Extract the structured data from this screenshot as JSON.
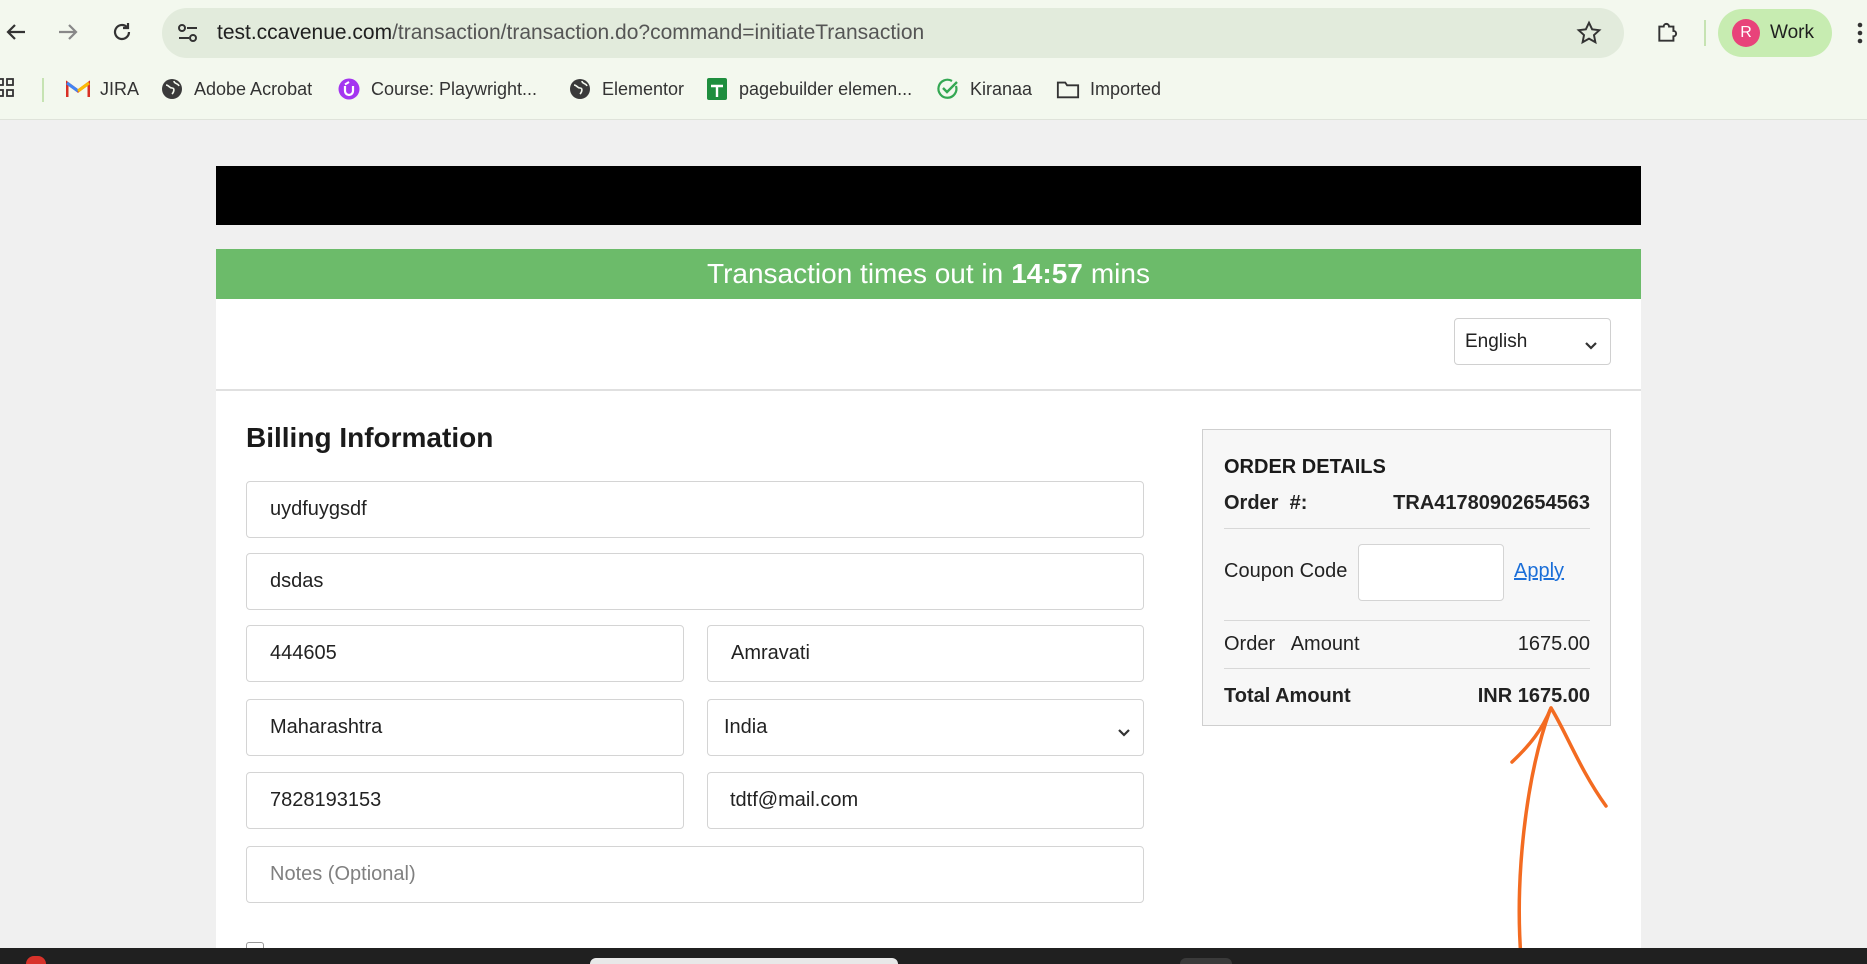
{
  "browser": {
    "url_host": "test.ccavenue.com",
    "url_path": "/transaction/transaction.do?command=initiateTransaction",
    "profile_initial": "R",
    "profile_name": "Work",
    "bookmarks": [
      {
        "label": "JIRA",
        "icon": "gmail-icon"
      },
      {
        "label": "Adobe Acrobat",
        "icon": "globe-icon"
      },
      {
        "label": "Course: Playwright...",
        "icon": "course-icon"
      },
      {
        "label": "Elementor",
        "icon": "globe-icon"
      },
      {
        "label": "pagebuilder elemen...",
        "icon": "sheets-icon"
      },
      {
        "label": "Kiranaa",
        "icon": "check-icon"
      },
      {
        "label": "Imported",
        "icon": "folder-icon"
      }
    ]
  },
  "timeout": {
    "prefix": "Transaction times out in",
    "time": "14:57",
    "suffix": "mins"
  },
  "language": {
    "selected": "English"
  },
  "billing": {
    "title": "Billing Information",
    "name": "uydfuygsdf",
    "address": "dsdas",
    "zip": "444605",
    "city": "Amravati",
    "state": "Maharashtra",
    "country": "India",
    "phone": "7828193153",
    "email": "tdtf@mail.com",
    "notes_placeholder": "Notes (Optional)"
  },
  "order": {
    "title": "ORDER DETAILS",
    "order_no_label": "Order  #:",
    "order_no": "TRA41780902654563",
    "coupon_label": "Coupon Code",
    "apply_label": "Apply",
    "amount_label": "Order   Amount",
    "amount": "1675.00",
    "total_label": "Total Amount",
    "total": "INR 1675.00"
  },
  "colors": {
    "timeout_bar": "#6cbb6a",
    "link": "#1a6ed8",
    "annotation": "#f36b21"
  }
}
